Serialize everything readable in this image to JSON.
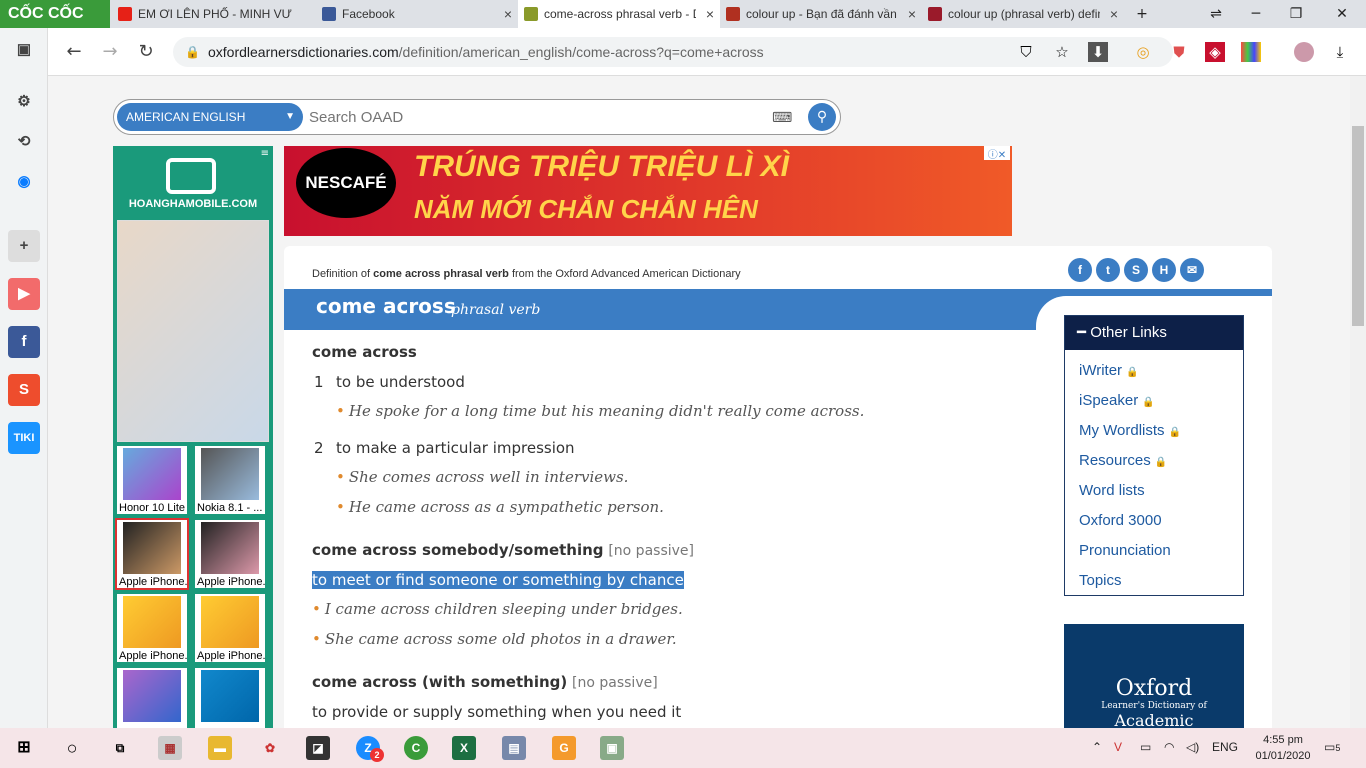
{
  "browser": {
    "logo": "CỐC CỐC",
    "tabs": [
      {
        "title": "EM ƠI LÊN PHỐ - MINH VƯƠNG",
        "color": "#e62117"
      },
      {
        "title": "Facebook",
        "color": "#3b5998"
      },
      {
        "title": "come-across phrasal verb - Definition",
        "color": "#8a9a2a"
      },
      {
        "title": "colour up - Bạn đã đánh vần",
        "color": "#b03020"
      },
      {
        "title": "colour up (phrasal verb) definition",
        "color": "#9a1a2a"
      }
    ],
    "url_domain": "oxfordlearnersdictionaries.com",
    "url_path": "/definition/american_english/come-across?q=come+across"
  },
  "search": {
    "lang": "AMERICAN ENGLISH",
    "placeholder": "Search OAAD"
  },
  "left_ad": {
    "brand": "HOANGHAMOBILE.COM",
    "phones": [
      "Honor 10 Lite",
      "Nokia 8.1 - ...",
      "Apple iPhone...",
      "Apple iPhone...",
      "Apple iPhone...",
      "Apple iPhone...",
      "",
      ""
    ]
  },
  "top_ad": {
    "brand": "NESCAFÉ",
    "line1": "TRÚNG TRIỆU TRIỆU LÌ XÌ",
    "line2": "NĂM MỚI CHẮN CHẮN HÊN"
  },
  "entry": {
    "crumb_pre": "Definition of ",
    "crumb_word": "come across phrasal verb",
    "crumb_post": " from the Oxford Advanced American Dictionary",
    "headword": "come across",
    "pos": "phrasal verb",
    "senses": [
      {
        "head": "come across",
        "items": [
          {
            "num": "1",
            "def": "to be understood",
            "examples": [
              "He spoke for a long time but his meaning didn't really come across."
            ]
          },
          {
            "num": "2",
            "def": "to make a particular impression",
            "examples": [
              "She comes across well in interviews.",
              "He came across as a sympathetic person."
            ]
          }
        ]
      },
      {
        "head": "come across somebody/something",
        "note": "[no passive]",
        "def": "to meet or find someone or something by chance",
        "examples": [
          "I came across children sleeping under bridges.",
          "She came across some old photos in a drawer."
        ]
      },
      {
        "head": "come across (with something)",
        "note": "[no passive]",
        "def": "to provide or supply something when you need it"
      }
    ]
  },
  "other_links": {
    "title": "Other Links",
    "items": [
      "iWriter",
      "iSpeaker",
      "My Wordlists",
      "Resources",
      "Word lists",
      "Oxford 3000",
      "Pronunciation",
      "Topics"
    ],
    "locked": [
      true,
      true,
      true,
      true,
      false,
      false,
      false,
      false
    ]
  },
  "oxford_ad": {
    "title": "Oxford",
    "sub": "Learner's Dictionary of",
    "title2": "Academic"
  },
  "taskbar": {
    "lang": "ENG",
    "time": "4:55 pm",
    "date": "01/01/2020",
    "notif": "5",
    "badge": "2"
  },
  "colors": {
    "accent": "#3b7dc4",
    "navy": "#0d2048"
  }
}
